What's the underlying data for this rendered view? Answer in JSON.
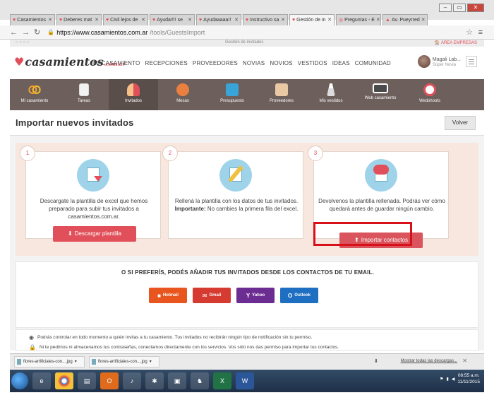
{
  "browser": {
    "tabs": [
      {
        "label": "Casamientos",
        "active": false
      },
      {
        "label": "Deberes mat",
        "active": false
      },
      {
        "label": "Civil lejos de",
        "active": false
      },
      {
        "label": "Ayuda!!!! se",
        "active": false
      },
      {
        "label": "Ayudaaaaa!!",
        "active": false
      },
      {
        "label": "Instructivo sa",
        "active": false
      },
      {
        "label": "Gestión de in",
        "active": true
      },
      {
        "label": "Preguntas - E",
        "active": false
      },
      {
        "label": "Av. Pueyrred",
        "active": false
      }
    ],
    "url_host": "https://www.casamientos.com.ar",
    "url_path": "/tools/GuestsImport"
  },
  "site_strip": {
    "title": "Gestión de invitados",
    "empresas": "ÁREA EMPRESAS"
  },
  "header": {
    "logo_text": "casamientos",
    "logo_tld": ".com.ar",
    "nav": [
      "MI CASAMIENTO",
      "RECEPCIONES",
      "PROVEEDORES",
      "NOVIAS",
      "NOVIOS",
      "VESTIDOS",
      "IDEAS",
      "COMUNIDAD"
    ],
    "user_name": "Magali Lab...",
    "user_role": "Súper Novia"
  },
  "tools": [
    {
      "label": "Mi casamiento",
      "icon": "rings-icon"
    },
    {
      "label": "Tareas",
      "icon": "tasks-icon"
    },
    {
      "label": "Invitados",
      "icon": "guests-icon",
      "active": true
    },
    {
      "label": "Mesas",
      "icon": "tables-icon"
    },
    {
      "label": "Presupuesto",
      "icon": "budget-icon"
    },
    {
      "label": "Proveedores",
      "icon": "vendors-icon"
    },
    {
      "label": "Mis vestidos",
      "icon": "dress-icon"
    },
    {
      "label": "Web casamiento",
      "icon": "website-icon"
    },
    {
      "label": "Wedshoots",
      "icon": "wedshoots-icon"
    }
  ],
  "page": {
    "title": "Importar nuevos invitados",
    "back_label": "Volver"
  },
  "steps": [
    {
      "num": "1",
      "text": "Descargate la plantilla de excel que hemos preparado para subir tus invitados a casamientos.com.ar.",
      "button": "Descargar plantilla"
    },
    {
      "num": "2",
      "text_pre": "Rellená la plantilla con los datos de tus invitados.",
      "text_bold": "Importante:",
      "text_post": "No cambies la primera fila del excel."
    },
    {
      "num": "3",
      "text": "Devolvenos la plantilla rellenada. Podrás ver cómo quedará antes de guardar ningún cambio.",
      "button": "Importar contactos"
    }
  ],
  "email": {
    "title": "O SI PREFERÍS, PODÉS AÑADIR TUS INVITADOS DESDE LOS CONTACTOS DE TU EMAIL.",
    "providers": [
      "Hotmail",
      "Gmail",
      "Yahoo",
      "Outlook"
    ]
  },
  "privacy": {
    "line1": "Podrás controlar en todo momento a quién invitas a tu casamiento. Tus invitados no recibirán ningún tipo de notificación sin tu permiso.",
    "line2": "Ni te pedimos ni almacenamos tus contraseñas, conectamos directamente con los servicios. Vos sólo nos das permiso para importar tus contactos."
  },
  "downloads": {
    "items": [
      "flores-artificiales-con....jpg",
      "flores-artificiales-con....jpg"
    ],
    "show_all": "Mostrar todas las descargas..."
  },
  "taskbar": {
    "time": "08:55 a.m.",
    "date": "11/11/2015"
  }
}
